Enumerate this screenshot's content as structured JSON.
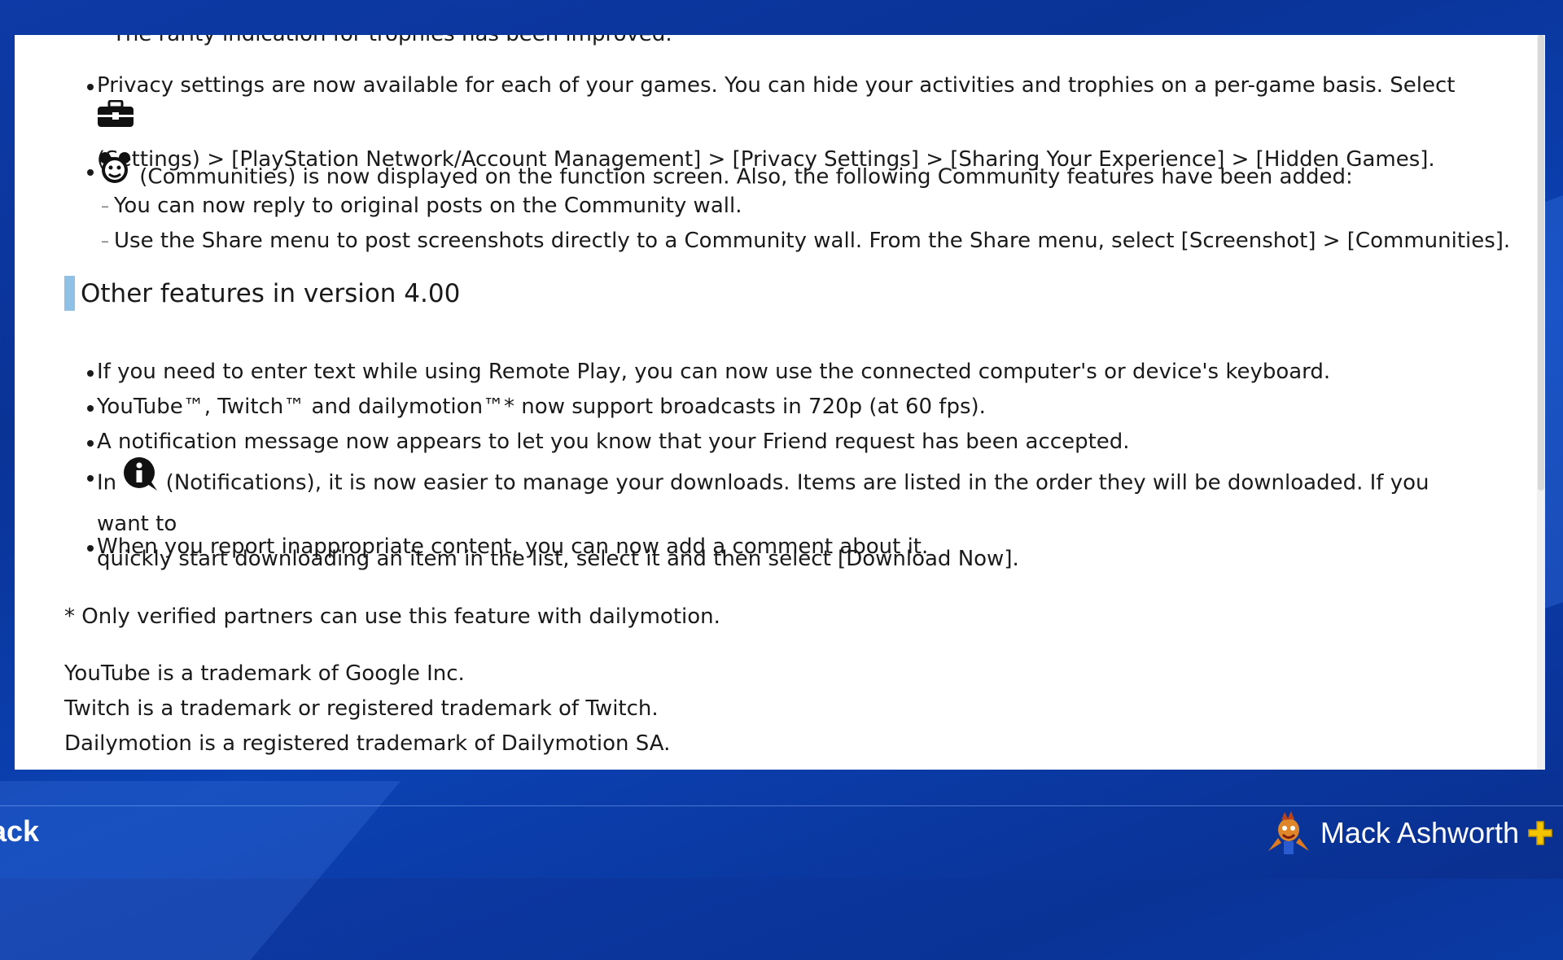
{
  "top_cut_text": "The rarity indication for trophies has been improved.",
  "bullets_top": [
    {
      "line1": "Privacy settings are now available for each of your games. You can hide your activities and trophies on a per-game basis. Select ",
      "icon": "toolbox-icon",
      "line2": "(Settings) > [PlayStation Network/Account Management] > [Privacy Settings] > [Sharing Your Experience] > [Hidden Games]."
    },
    {
      "icon": "communities-icon",
      "text": " (Communities) is now displayed on the function screen. Also, the following Community features have been added:",
      "subitems": [
        "You can now reply to original posts on the Community wall.",
        "Use the Share menu to post screenshots directly to a Community wall. From the Share menu, select [Screenshot] > [Communities]."
      ]
    }
  ],
  "section_heading": "Other features in version 4.00",
  "bullets_other": [
    "If you need to enter text while using Remote Play, you can now use the connected computer's or device's keyboard.",
    "YouTube™, Twitch™ and dailymotion™* now support broadcasts in 720p (at 60 fps).",
    "A notification message now appears to let you know that your Friend request has been accepted."
  ],
  "notifications_bullet": {
    "prefix": "In ",
    "icon": "info-icon",
    "line1": " (Notifications), it is now easier to manage your downloads. Items are listed in the order they will be downloaded. If you want to",
    "line2": "quickly start downloading an item in the list, select it and then select [Download Now]."
  },
  "last_bullet": "When you report inappropriate content, you can now add a comment about it.",
  "footnote": "* Only verified partners can use this feature with dailymotion.",
  "trademarks": [
    "YouTube is a trademark of Google Inc.",
    "Twitch is a trademark or registered trademark of Twitch.",
    "Dailymotion is a registered trademark of Dailymotion SA."
  ],
  "footer": {
    "back_label": "ack",
    "username": "Mack Ashworth",
    "plus_icon": "ps-plus-icon",
    "avatar_icon": "avatar-icon"
  },
  "colors": {
    "background": "#0b3aa8",
    "heading_bar": "#8fc0e6",
    "plus": "#f5c400"
  }
}
